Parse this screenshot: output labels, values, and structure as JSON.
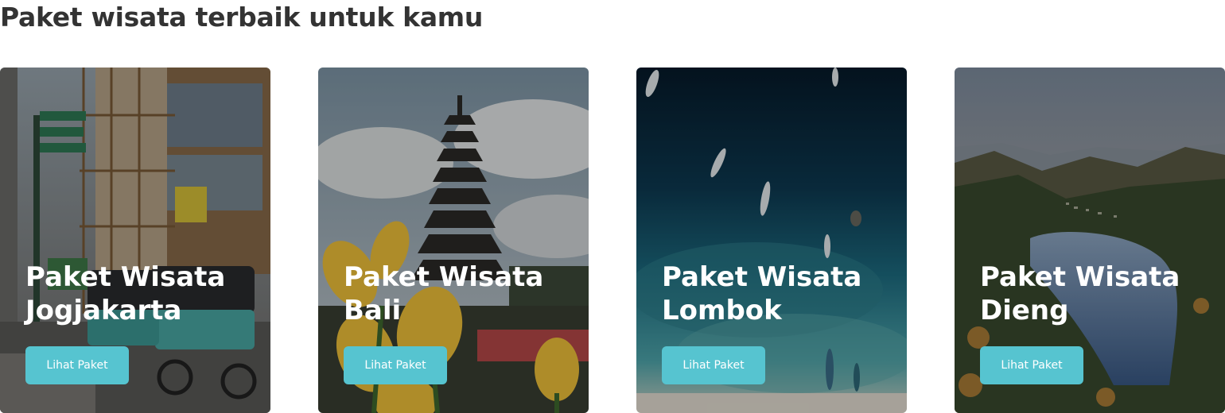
{
  "section": {
    "title": "Paket wisata terbaik untuk kamu"
  },
  "cards": [
    {
      "title_line1": "Paket Wisata",
      "title_line2": "Jogjakarta",
      "button_label": "Lihat Paket",
      "image": "jogjakarta-street-becak-photo"
    },
    {
      "title_line1": "Paket Wisata",
      "title_line2": "Bali",
      "button_label": "Lihat Paket",
      "image": "bali-temple-pagoda-photo"
    },
    {
      "title_line1": "Paket Wisata",
      "title_line2": "Lombok",
      "button_label": "Lihat Paket",
      "image": "lombok-aerial-sea-boats-photo"
    },
    {
      "title_line1": "Paket Wisata",
      "title_line2": "Dieng",
      "button_label": "Lihat Paket",
      "image": "dieng-mountain-lake-photo"
    }
  ],
  "colors": {
    "button": "#56c4d0",
    "heading": "#333333"
  }
}
